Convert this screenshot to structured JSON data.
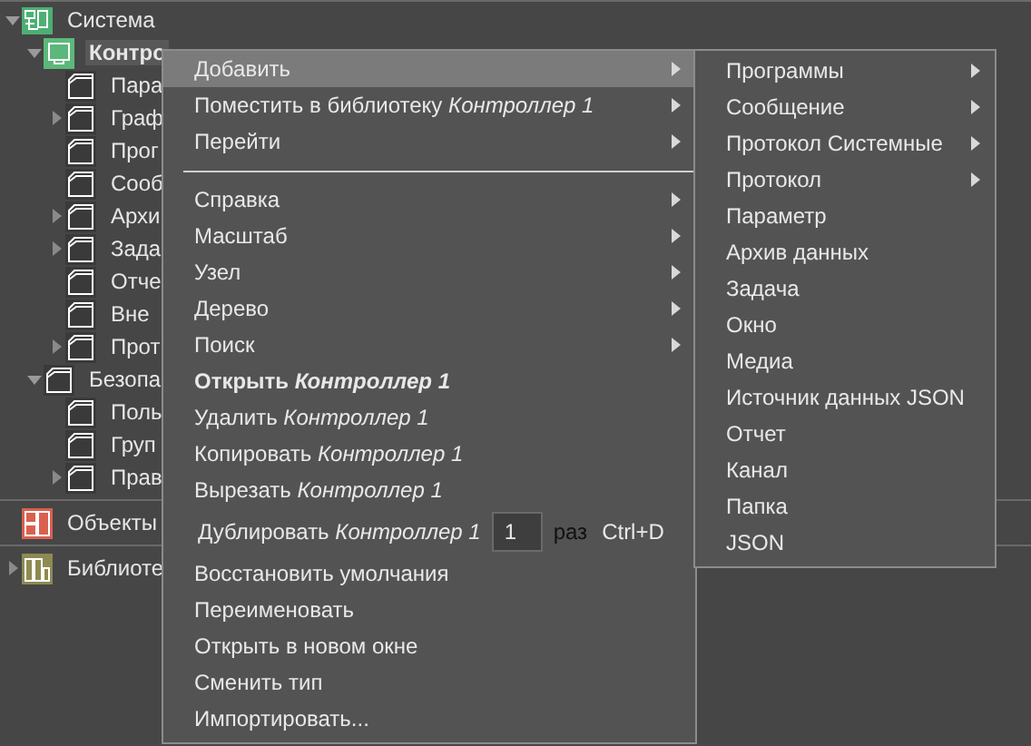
{
  "tree": [
    {
      "label": "Система",
      "expanded": true,
      "selected": false,
      "children": [
        {
          "label": "Контро",
          "expanded": true,
          "selected": true,
          "children": [
            {
              "label": "Пара",
              "selected": false
            },
            {
              "label": "Граф",
              "expanded": false,
              "selected": false
            },
            {
              "label": "Прог",
              "selected": false
            },
            {
              "label": "Сооб",
              "selected": false
            },
            {
              "label": "Архи",
              "expanded": false,
              "selected": false
            },
            {
              "label": "Зада",
              "expanded": false,
              "selected": false
            },
            {
              "label": "Отче",
              "selected": false
            },
            {
              "label": "Вне",
              "selected": false
            },
            {
              "label": "Прот",
              "expanded": false,
              "selected": false
            }
          ]
        },
        {
          "label": "Безопа",
          "expanded": true,
          "selected": false,
          "children": [
            {
              "label": "Поль",
              "selected": false
            },
            {
              "label": "Груп",
              "selected": false
            },
            {
              "label": "Прав",
              "expanded": false,
              "selected": false
            }
          ]
        }
      ]
    }
  ],
  "sections": [
    {
      "label": "Объекты"
    },
    {
      "label": "Библиоте",
      "expanded": false
    }
  ],
  "context_menu": {
    "items": [
      {
        "kind": "submenu",
        "label": "Добавить",
        "selected": true
      },
      {
        "kind": "submenu",
        "label": "Поместить в библиотеку *Контроллер 1*",
        "selected": false
      },
      {
        "kind": "submenu",
        "label": "Перейти",
        "selected": false
      },
      {
        "kind": "separator"
      },
      {
        "kind": "submenu",
        "label": "Справка",
        "selected": false
      },
      {
        "kind": "submenu",
        "label": "Масштаб",
        "selected": false
      },
      {
        "kind": "submenu",
        "label": "Узел",
        "selected": false
      },
      {
        "kind": "submenu",
        "label": "Дерево",
        "selected": false
      },
      {
        "kind": "submenu",
        "label": "Поиск",
        "selected": false
      },
      {
        "kind": "bold",
        "label": "Открыть *Контроллер 1*",
        "selected": false
      },
      {
        "kind": "plain",
        "label": "Удалить *Контроллер 1*",
        "selected": false
      },
      {
        "kind": "plain",
        "label": "Копировать *Контроллер 1*",
        "selected": false
      },
      {
        "kind": "plain",
        "label": "Вырезать *Контроллер 1*",
        "selected": false
      },
      {
        "kind": "duplicate",
        "label": "Дублировать *Контроллер 1*",
        "value": "1",
        "suffix": "раз",
        "shortcut": "Ctrl+D",
        "selected": false
      },
      {
        "kind": "plain",
        "label": "Восстановить умолчания",
        "selected": false
      },
      {
        "kind": "plain",
        "label": "Переименовать",
        "selected": false
      },
      {
        "kind": "plain",
        "label": "Открыть в новом окне",
        "selected": false
      },
      {
        "kind": "plain",
        "label": "Сменить тип",
        "selected": false
      },
      {
        "kind": "plain",
        "label": "Импортировать...",
        "selected": false
      }
    ]
  },
  "submenu": {
    "items": [
      {
        "kind": "submenu",
        "label": "Программы"
      },
      {
        "kind": "submenu",
        "label": "Сообщение"
      },
      {
        "kind": "submenu",
        "label": "Протокол Системные"
      },
      {
        "kind": "submenu",
        "label": "Протокол"
      },
      {
        "kind": "plain",
        "label": "Параметр"
      },
      {
        "kind": "plain",
        "label": "Архив данных"
      },
      {
        "kind": "plain",
        "label": "Задача"
      },
      {
        "kind": "plain",
        "label": "Окно"
      },
      {
        "kind": "plain",
        "label": "Медиа"
      },
      {
        "kind": "plain",
        "label": "Источник данных JSON"
      },
      {
        "kind": "plain",
        "label": "Отчет"
      },
      {
        "kind": "plain",
        "label": "Канал"
      },
      {
        "kind": "plain",
        "label": "Папка"
      },
      {
        "kind": "plain",
        "label": "JSON"
      }
    ]
  }
}
